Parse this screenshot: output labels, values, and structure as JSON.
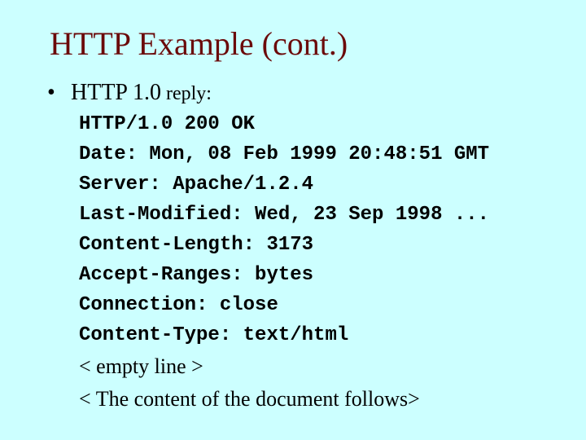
{
  "slide": {
    "title": "HTTP Example (cont.)",
    "bullet": {
      "symbol": "•",
      "text_main": "HTTP 1.0",
      "text_small": " reply:"
    },
    "response_lines": [
      "HTTP/1.0 200 OK",
      "Date: Mon, 08 Feb 1999 20:48:51 GMT",
      "Server: Apache/1.2.4",
      "Last-Modified: Wed, 23 Sep 1998 ...",
      "Content-Length: 3173",
      "Accept-Ranges: bytes",
      "Connection: close",
      "Content-Type: text/html"
    ],
    "notes": [
      "< empty line >",
      "< The content of the document follows>"
    ],
    "colors": {
      "background": "#ccffff",
      "title": "#6b0a0a",
      "text": "#000000"
    }
  }
}
